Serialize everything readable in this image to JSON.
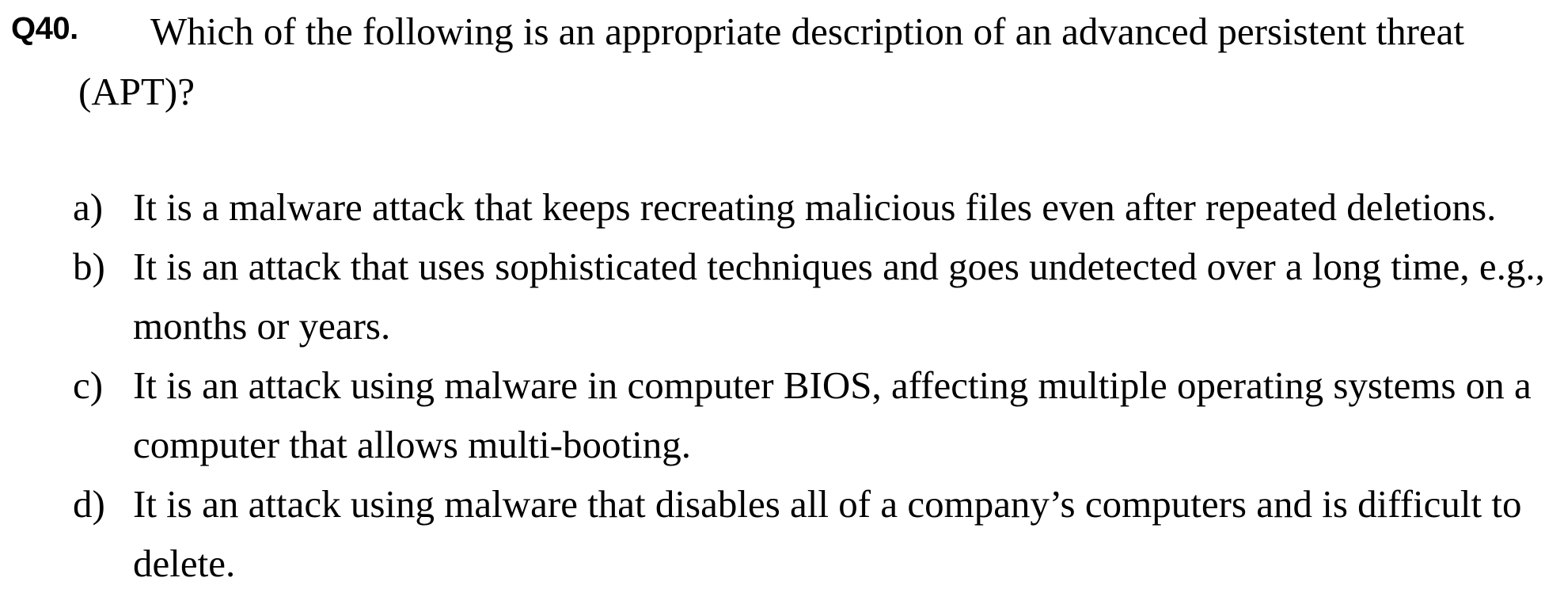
{
  "question": {
    "number": "Q40.",
    "text": "Which of the following is an appropriate description of an advanced persistent threat (APT)?"
  },
  "options": [
    {
      "letter": "a)",
      "text": "It is a malware attack that keeps recreating malicious files even after repeated deletions."
    },
    {
      "letter": "b)",
      "text": "It is an attack that uses sophisticated techniques and goes undetected over a long time, e.g., months or years."
    },
    {
      "letter": "c)",
      "text": "It is an attack using malware in computer BIOS, affecting multiple operating systems on a computer that allows multi-booting."
    },
    {
      "letter": "d)",
      "text": "It is an attack using malware that disables all of a company’s computers and is difficult to delete."
    }
  ]
}
